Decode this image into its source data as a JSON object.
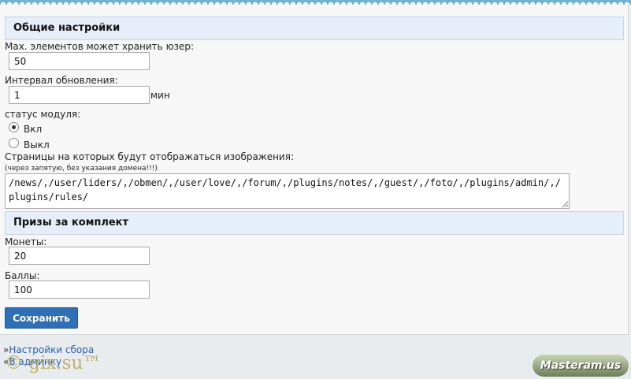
{
  "general": {
    "title": "Общие настройки",
    "max_items_label": "Мах. элементов может хранить юзер:",
    "max_items_value": "50",
    "interval_label": "Интервал обновления:",
    "interval_value": "1",
    "interval_unit": "мин",
    "status_label": "статус модуля:",
    "status_on": "Вкл",
    "status_off": "Выкл",
    "status_selected": "Вкл",
    "pages_label": "Страницы на которых будут отображаться изображения:",
    "pages_hint": "(через запятую, без указания домена!!!)",
    "pages_value": "/news/,/user/liders/,/obmen/,/user/love/,/forum/,/plugins/notes/,/guest/,/foto/,/plugins/admin/,/plugins/rules/"
  },
  "prizes": {
    "title": "Призы за комплект",
    "coins_label": "Монеты:",
    "coins_value": "20",
    "points_label": "Баллы:",
    "points_value": "100"
  },
  "save_label": "Сохранить",
  "footer": {
    "link1_arrow": "»",
    "link1": "Настройки сбора",
    "link2_arrow": "«",
    "link2": "В админку"
  },
  "watermark": "© gix.su™",
  "logo": "Masteram.us"
}
